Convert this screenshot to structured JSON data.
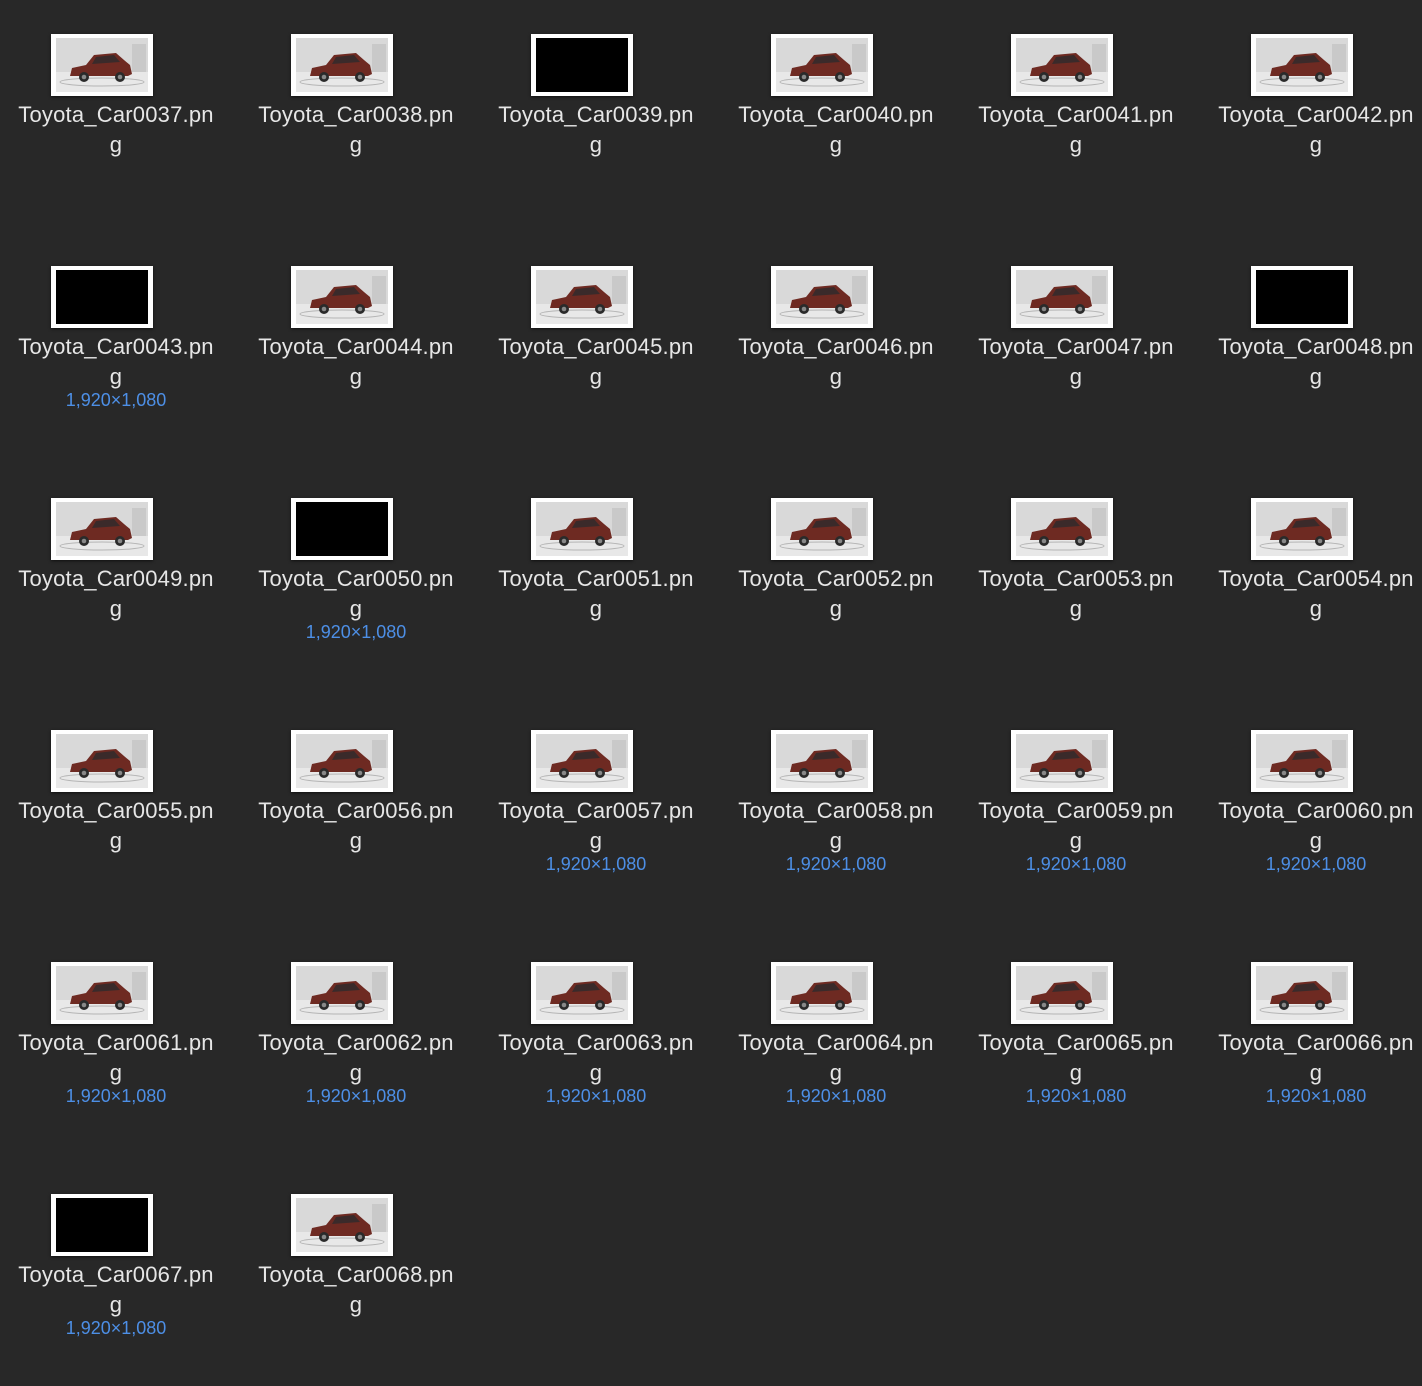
{
  "files": [
    {
      "name_line1": "Toyota_Car0037.pn",
      "name_line2": "g",
      "thumb": "car",
      "dims": ""
    },
    {
      "name_line1": "Toyota_Car0038.pn",
      "name_line2": "g",
      "thumb": "car",
      "dims": ""
    },
    {
      "name_line1": "Toyota_Car0039.pn",
      "name_line2": "g",
      "thumb": "black",
      "dims": ""
    },
    {
      "name_line1": "Toyota_Car0040.pn",
      "name_line2": "g",
      "thumb": "car",
      "dims": ""
    },
    {
      "name_line1": "Toyota_Car0041.pn",
      "name_line2": "g",
      "thumb": "car",
      "dims": ""
    },
    {
      "name_line1": "Toyota_Car0042.pn",
      "name_line2": "g",
      "thumb": "car",
      "dims": ""
    },
    {
      "name_line1": "Toyota_Car0043.pn",
      "name_line2": "g",
      "thumb": "black",
      "dims": "1,920×1,080"
    },
    {
      "name_line1": "Toyota_Car0044.pn",
      "name_line2": "g",
      "thumb": "car",
      "dims": ""
    },
    {
      "name_line1": "Toyota_Car0045.pn",
      "name_line2": "g",
      "thumb": "car",
      "dims": ""
    },
    {
      "name_line1": "Toyota_Car0046.pn",
      "name_line2": "g",
      "thumb": "car",
      "dims": ""
    },
    {
      "name_line1": "Toyota_Car0047.pn",
      "name_line2": "g",
      "thumb": "car",
      "dims": ""
    },
    {
      "name_line1": "Toyota_Car0048.pn",
      "name_line2": "g",
      "thumb": "black",
      "dims": ""
    },
    {
      "name_line1": "Toyota_Car0049.pn",
      "name_line2": "g",
      "thumb": "car",
      "dims": ""
    },
    {
      "name_line1": "Toyota_Car0050.pn",
      "name_line2": "g",
      "thumb": "black",
      "dims": "1,920×1,080"
    },
    {
      "name_line1": "Toyota_Car0051.pn",
      "name_line2": "g",
      "thumb": "car",
      "dims": ""
    },
    {
      "name_line1": "Toyota_Car0052.pn",
      "name_line2": "g",
      "thumb": "car",
      "dims": ""
    },
    {
      "name_line1": "Toyota_Car0053.pn",
      "name_line2": "g",
      "thumb": "car",
      "dims": ""
    },
    {
      "name_line1": "Toyota_Car0054.pn",
      "name_line2": "g",
      "thumb": "car",
      "dims": ""
    },
    {
      "name_line1": "Toyota_Car0055.pn",
      "name_line2": "g",
      "thumb": "car",
      "dims": ""
    },
    {
      "name_line1": "Toyota_Car0056.pn",
      "name_line2": "g",
      "thumb": "car",
      "dims": ""
    },
    {
      "name_line1": "Toyota_Car0057.pn",
      "name_line2": "g",
      "thumb": "car",
      "dims": "1,920×1,080"
    },
    {
      "name_line1": "Toyota_Car0058.pn",
      "name_line2": "g",
      "thumb": "car",
      "dims": "1,920×1,080"
    },
    {
      "name_line1": "Toyota_Car0059.pn",
      "name_line2": "g",
      "thumb": "car",
      "dims": "1,920×1,080"
    },
    {
      "name_line1": "Toyota_Car0060.pn",
      "name_line2": "g",
      "thumb": "car",
      "dims": "1,920×1,080"
    },
    {
      "name_line1": "Toyota_Car0061.pn",
      "name_line2": "g",
      "thumb": "car",
      "dims": "1,920×1,080"
    },
    {
      "name_line1": "Toyota_Car0062.pn",
      "name_line2": "g",
      "thumb": "car",
      "dims": "1,920×1,080"
    },
    {
      "name_line1": "Toyota_Car0063.pn",
      "name_line2": "g",
      "thumb": "car",
      "dims": "1,920×1,080"
    },
    {
      "name_line1": "Toyota_Car0064.pn",
      "name_line2": "g",
      "thumb": "car",
      "dims": "1,920×1,080"
    },
    {
      "name_line1": "Toyota_Car0065.pn",
      "name_line2": "g",
      "thumb": "car",
      "dims": "1,920×1,080"
    },
    {
      "name_line1": "Toyota_Car0066.pn",
      "name_line2": "g",
      "thumb": "car",
      "dims": "1,920×1,080"
    },
    {
      "name_line1": "Toyota_Car0067.pn",
      "name_line2": "g",
      "thumb": "black",
      "dims": "1,920×1,080"
    },
    {
      "name_line1": "Toyota_Car0068.pn",
      "name_line2": "g",
      "thumb": "car",
      "dims": ""
    }
  ],
  "colors": {
    "background": "#282828",
    "filename_text": "#e6e6e6",
    "dimensions_text": "#4d8fe6",
    "car_body": "#6e2a22"
  }
}
